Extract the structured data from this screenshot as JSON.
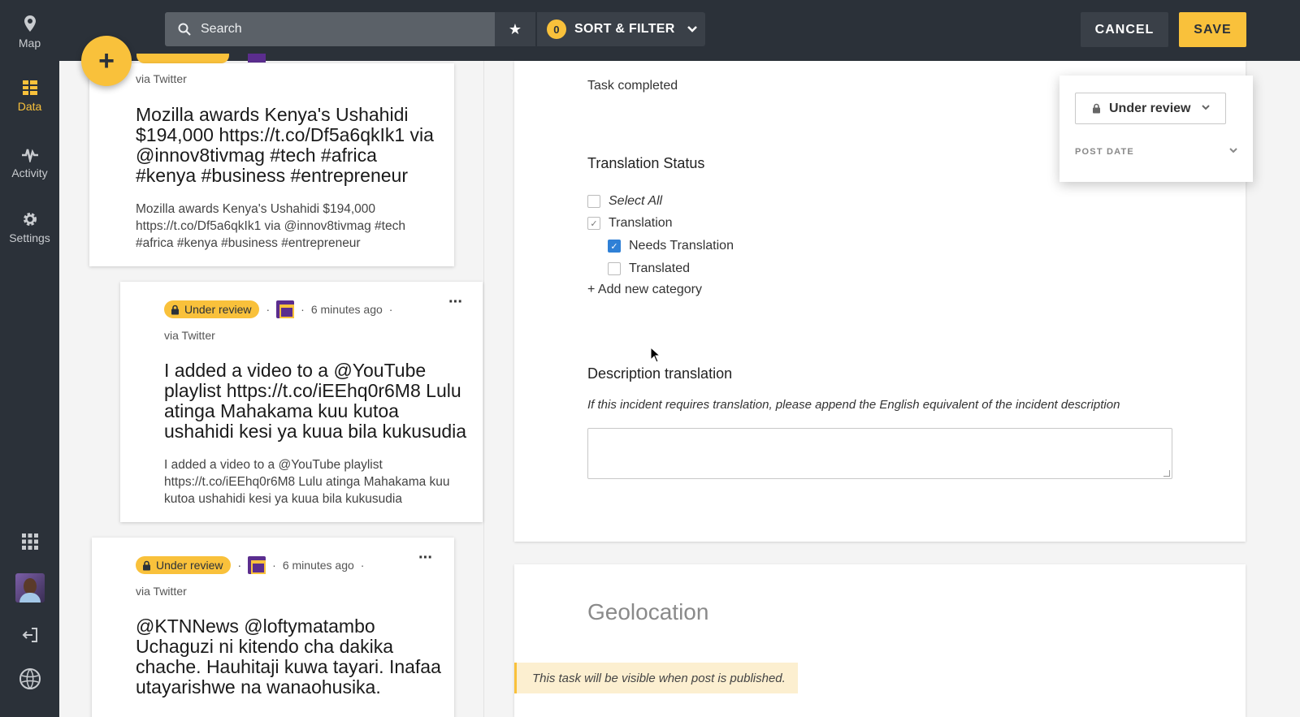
{
  "nav": {
    "items": [
      {
        "label": "Map",
        "icon": "map-pin-icon"
      },
      {
        "label": "Data",
        "icon": "data-list-icon",
        "active": true
      },
      {
        "label": "Activity",
        "icon": "activity-pulse-icon"
      },
      {
        "label": "Settings",
        "icon": "gear-icon"
      }
    ]
  },
  "toolbar": {
    "search_placeholder": "Search",
    "sort_count": "0",
    "sort_label": "SORT & FILTER",
    "cancel_label": "CANCEL",
    "save_label": "SAVE"
  },
  "fab": {
    "label": "+"
  },
  "posts": [
    {
      "via": "via Twitter",
      "title": "Mozilla awards Kenya's Ushahidi $194,000 https://t.co/Df5a6qkIk1 via @innov8tivmag #tech #africa #kenya #business #entrepreneur",
      "body": "Mozilla awards Kenya's Ushahidi $194,000 https://t.co/Df5a6qkIk1 via @innov8tivmag #tech #africa #kenya #business #entrepreneur"
    },
    {
      "status": "Under review",
      "time": "6 minutes ago",
      "via": "via Twitter",
      "more": "···",
      "title": "I added a video to a @YouTube playlist https://t.co/iEEhq0r6M8 Lulu atinga Mahakama kuu kutoa ushahidi kesi ya kuua bila kukusudia",
      "body": "I added a video to a @YouTube playlist https://t.co/iEEhq0r6M8 Lulu atinga Mahakama kuu kutoa ushahidi kesi ya kuua bila kukusudia"
    },
    {
      "status": "Under review",
      "time": "6 minutes ago",
      "via": "via Twitter",
      "more": "···",
      "title": "@KTNNews @loftymatambo Uchaguzi ni kitendo cha dakika chache. Hauhitaji kuwa tayari. Inafaa utayarishwe na wanaohusika."
    }
  ],
  "form": {
    "task_completed": "Task completed",
    "translation_status_label": "Translation Status",
    "options": {
      "select_all": "Select All",
      "translation": "Translation",
      "needs_translation": "Needs Translation",
      "translated": "Translated"
    },
    "add_category": "+ Add new category",
    "description_label": "Description translation",
    "description_help": "If this incident requires translation, please append the English equivalent of the incident description",
    "description_value": "",
    "geolocation_label": "Geolocation",
    "visibility_notice": "This task will be visible when post is published."
  },
  "status_popover": {
    "status_value": "Under review",
    "post_date_label": "POST DATE"
  },
  "colors": {
    "accent": "#f9c13b",
    "nav_bg": "#2b3139",
    "checkbox_checked": "#2f80d6"
  }
}
